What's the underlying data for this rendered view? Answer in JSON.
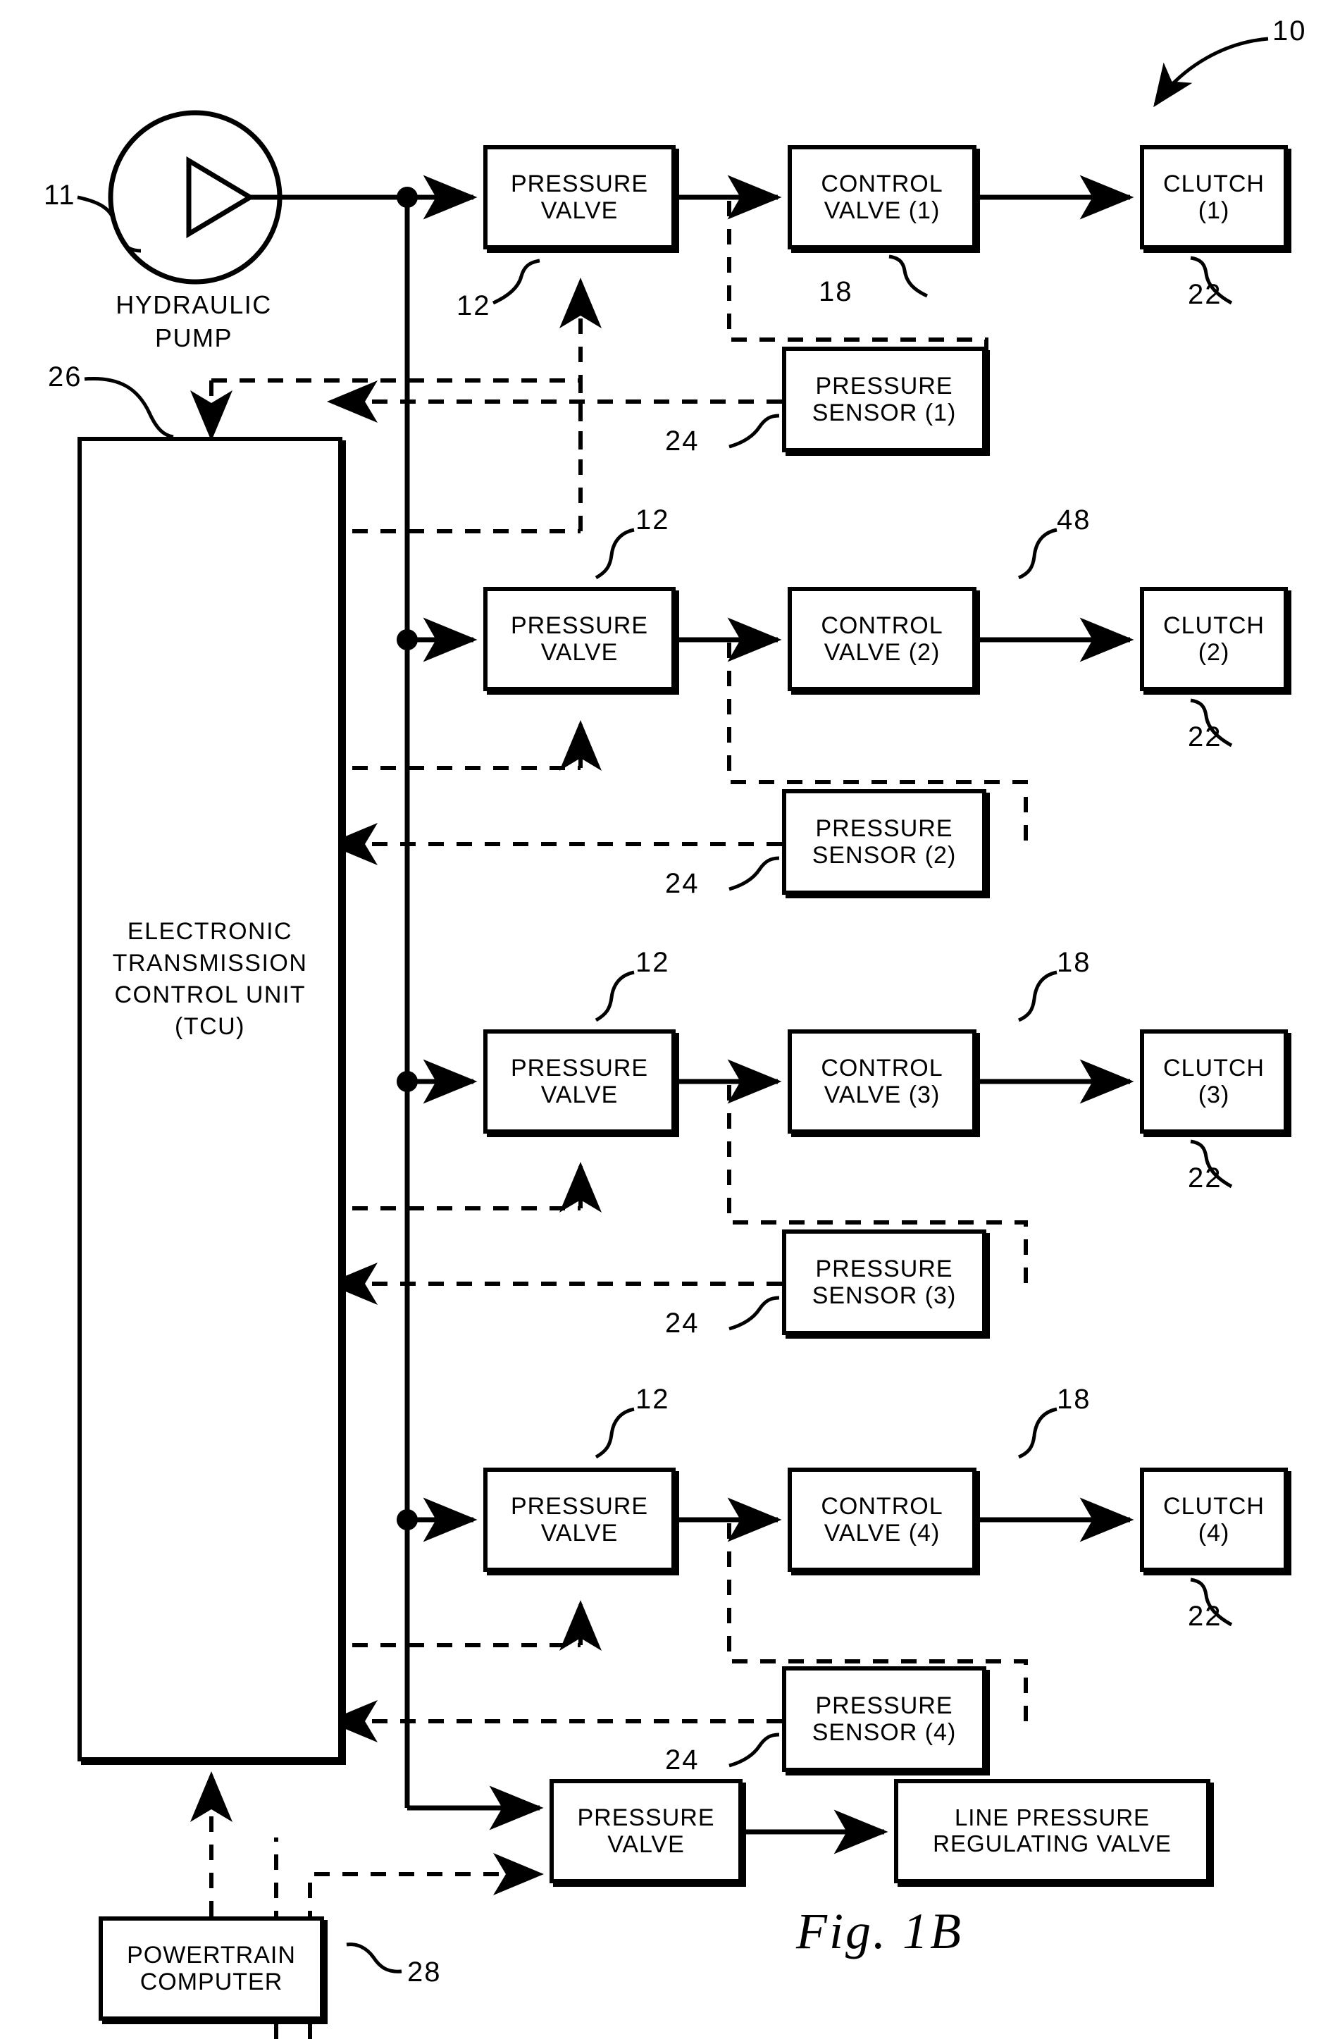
{
  "figure": {
    "caption": "Fig. 1B",
    "system_ref": "10"
  },
  "pump": {
    "label_line1": "HYDRAULIC",
    "label_line2": "PUMP",
    "ref": "11",
    "icon": "pump-triangle-icon"
  },
  "tcu": {
    "line1": "ELECTRONIC",
    "line2": "TRANSMISSION",
    "line3": "CONTROL UNIT",
    "line4": "(TCU)",
    "ref": "26"
  },
  "powertrain_computer": {
    "line1": "POWERTRAIN",
    "line2": "COMPUTER",
    "ref": "28"
  },
  "line_pressure": {
    "valve_line1": "PRESSURE",
    "valve_line2": "VALVE",
    "regulator_line1": "LINE PRESSURE",
    "regulator_line2": "REGULATING VALVE"
  },
  "channels": [
    {
      "pressure_valve_line1": "PRESSURE",
      "pressure_valve_line2": "VALVE",
      "pressure_valve_ref": "12",
      "control_valve_line1": "CONTROL",
      "control_valve_line2": "VALVE (1)",
      "control_valve_ref": "18",
      "clutch_line1": "CLUTCH",
      "clutch_line2": "(1)",
      "clutch_ref": "22",
      "sensor_line1": "PRESSURE",
      "sensor_line2": "SENSOR (1)",
      "sensor_ref": "24"
    },
    {
      "pressure_valve_line1": "PRESSURE",
      "pressure_valve_line2": "VALVE",
      "pressure_valve_ref": "12",
      "control_valve_line1": "CONTROL",
      "control_valve_line2": "VALVE (2)",
      "control_valve_ref": "48",
      "clutch_line1": "CLUTCH",
      "clutch_line2": "(2)",
      "clutch_ref": "22",
      "sensor_line1": "PRESSURE",
      "sensor_line2": "SENSOR (2)",
      "sensor_ref": "24"
    },
    {
      "pressure_valve_line1": "PRESSURE",
      "pressure_valve_line2": "VALVE",
      "pressure_valve_ref": "12",
      "control_valve_line1": "CONTROL",
      "control_valve_line2": "VALVE (3)",
      "control_valve_ref": "18",
      "clutch_line1": "CLUTCH",
      "clutch_line2": "(3)",
      "clutch_ref": "22",
      "sensor_line1": "PRESSURE",
      "sensor_line2": "SENSOR (3)",
      "sensor_ref": "24"
    },
    {
      "pressure_valve_line1": "PRESSURE",
      "pressure_valve_line2": "VALVE",
      "pressure_valve_ref": "12",
      "control_valve_line1": "CONTROL",
      "control_valve_line2": "VALVE (4)",
      "control_valve_ref": "18",
      "clutch_line1": "CLUTCH",
      "clutch_line2": "(4)",
      "clutch_ref": "22",
      "sensor_line1": "PRESSURE",
      "sensor_line2": "SENSOR (4)",
      "sensor_ref": "24"
    }
  ],
  "colors": {
    "ink": "#000000",
    "paper": "#ffffff"
  }
}
